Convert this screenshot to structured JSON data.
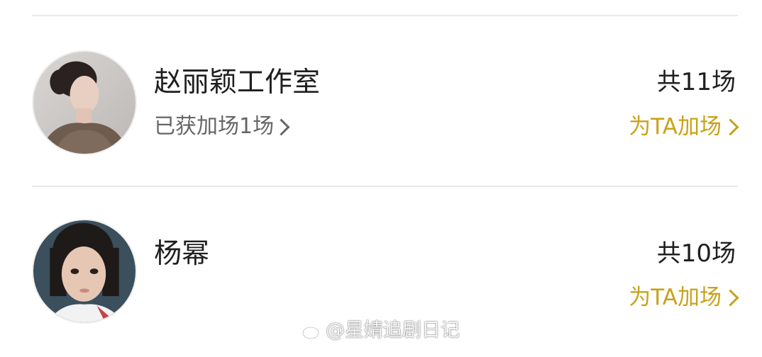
{
  "colors": {
    "accent": "#c9a21b",
    "divider": "#e9e9e9",
    "primary_text": "#1f1f1f",
    "secondary_text": "#666666"
  },
  "rows": [
    {
      "name": "赵丽颖工作室",
      "sub_text": "已获加场1场",
      "total": "共11场",
      "action_label": "为TA加场"
    },
    {
      "name": "杨幂",
      "total": "共10场",
      "action_label": "为TA加场"
    }
  ],
  "watermark": {
    "icon": "weibo-logo-icon",
    "text": "@星婧追剧日记"
  }
}
